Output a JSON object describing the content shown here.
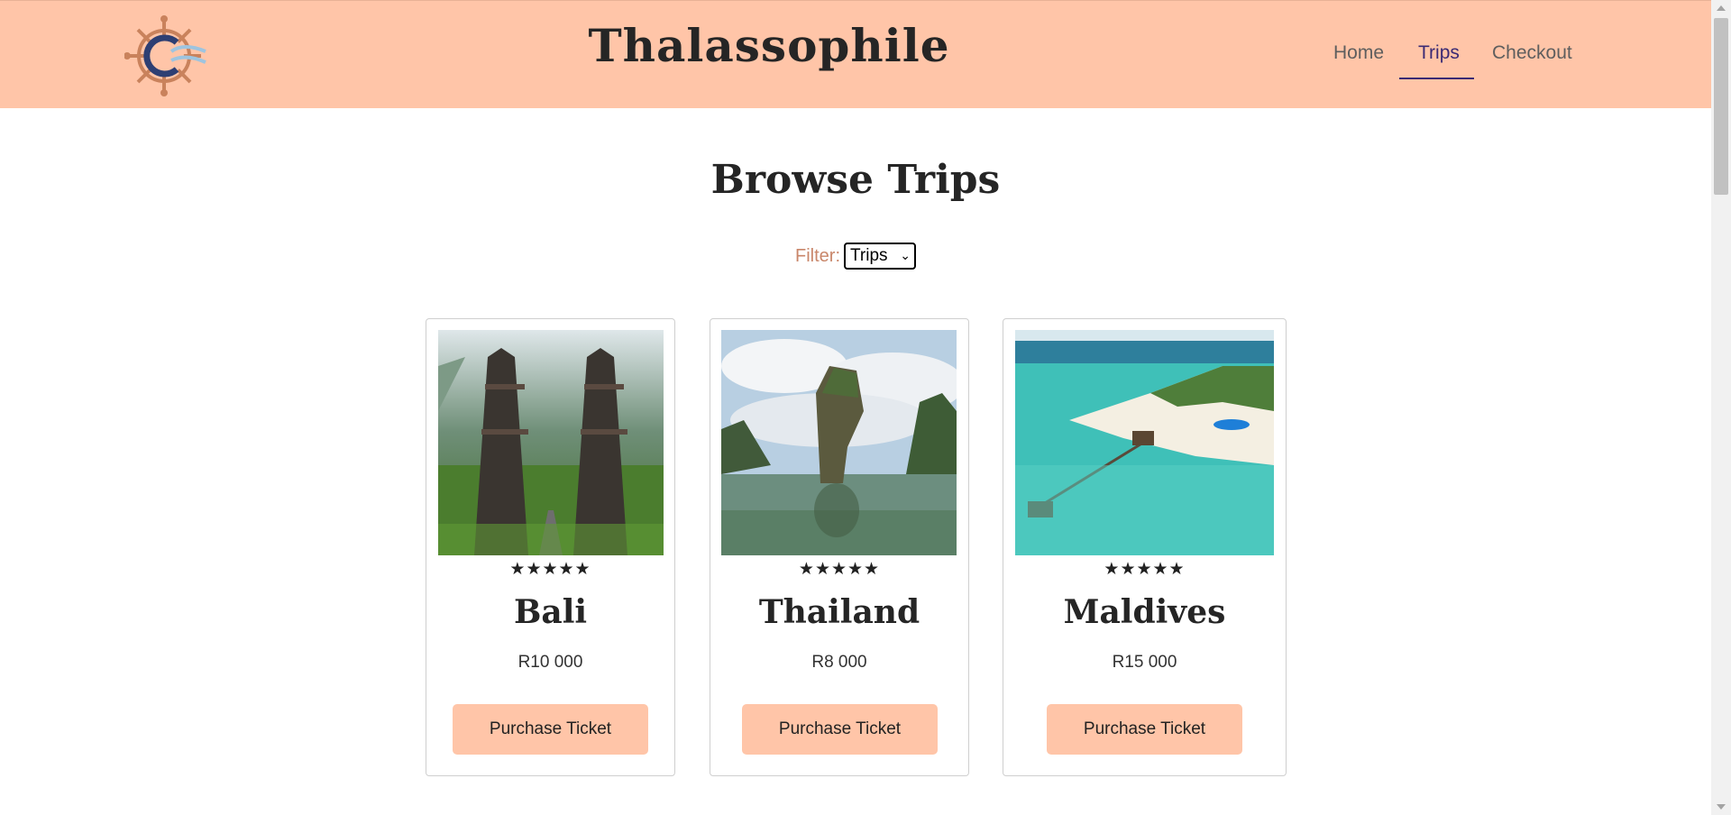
{
  "navbar": {
    "brand": "Thalassophile",
    "links": [
      "Home",
      "Trips",
      "Checkout"
    ],
    "active": "Trips",
    "background": "#ffc5a8",
    "active_color": "#3a2a74"
  },
  "main": {
    "title": "Browse Trips",
    "filter": {
      "label": "Filter:",
      "selected": "Trips"
    },
    "trips": [
      {
        "name": "Bali",
        "price": "R10 000",
        "rating": 5,
        "stars": "★★★★★",
        "button": "Purchase Ticket",
        "image_icon": "bali-gates-image"
      },
      {
        "name": "Thailand",
        "price": "R8 000",
        "rating": 5,
        "stars": "★★★★★",
        "button": "Purchase Ticket",
        "image_icon": "thailand-rock-image"
      },
      {
        "name": "Maldives",
        "price": "R15 000",
        "rating": 5,
        "stars": "★★★★★",
        "button": "Purchase Ticket",
        "image_icon": "maldives-resort-image"
      }
    ]
  }
}
